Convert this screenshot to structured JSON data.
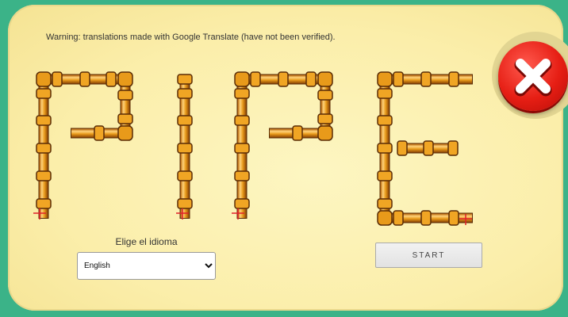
{
  "warning_text": "Warning: translations made with Google Translate (have not been verified).",
  "title_letters": [
    "P",
    "I",
    "P",
    "E"
  ],
  "language": {
    "label": "Elige el idioma",
    "selected": "English"
  },
  "start_label": "START",
  "close_icon": "close-x-icon",
  "colors": {
    "background": "#3bb388",
    "panel": "#fbeeaa",
    "pipe": "#e89a1a",
    "pipe_outline": "#5a2c06",
    "close": "#e61e14"
  }
}
